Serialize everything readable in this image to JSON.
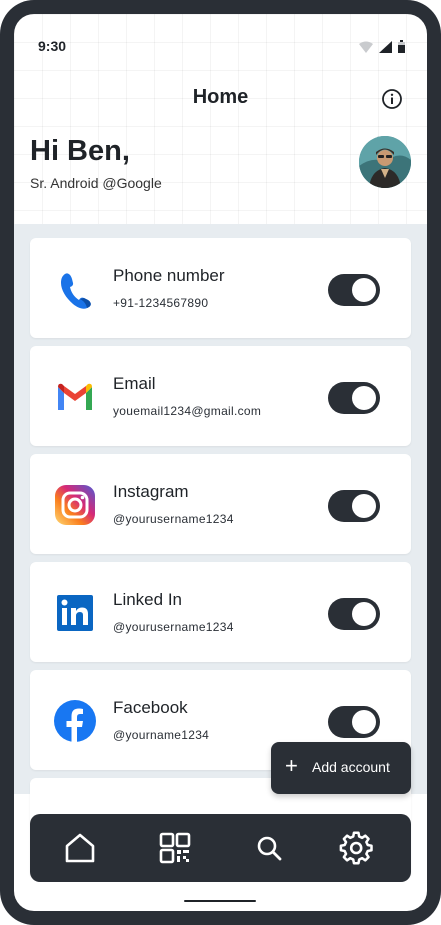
{
  "status_bar": {
    "time": "9:30"
  },
  "header": {
    "title": "Home"
  },
  "profile": {
    "greeting": "Hi Ben,",
    "subtitle": "Sr. Android @Google"
  },
  "accounts": [
    {
      "name": "Phone number",
      "detail": "+91-1234567890",
      "icon": "phone-icon",
      "enabled": true
    },
    {
      "name": "Email",
      "detail": "youemail1234@gmail.com",
      "icon": "gmail-icon",
      "enabled": true
    },
    {
      "name": "Instagram",
      "detail": "@yourusername1234",
      "icon": "instagram-icon",
      "enabled": true
    },
    {
      "name": "Linked In",
      "detail": "@yourusername1234",
      "icon": "linkedin-icon",
      "enabled": true
    },
    {
      "name": "Facebook",
      "detail": "@yourname1234",
      "icon": "facebook-icon",
      "enabled": true
    }
  ],
  "fab": {
    "label": "Add account"
  },
  "bottom_nav": {
    "items": [
      {
        "icon": "home-icon"
      },
      {
        "icon": "qr-code-icon"
      },
      {
        "icon": "search-icon"
      },
      {
        "icon": "gear-icon"
      }
    ]
  },
  "colors": {
    "dark": "#2a2f36",
    "background": "#e7ecf0",
    "card": "#ffffff"
  }
}
